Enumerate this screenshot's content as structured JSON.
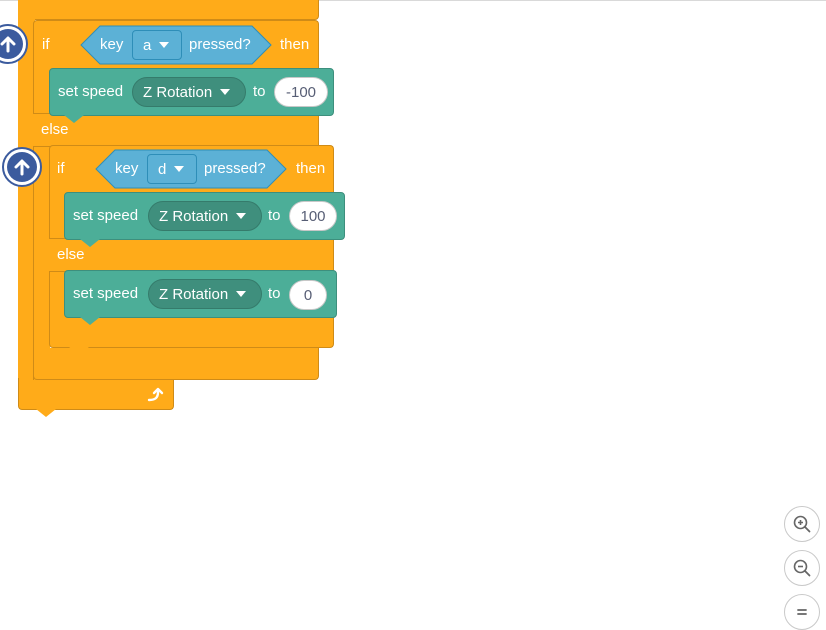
{
  "script": {
    "outer_if": {
      "if_label": "if",
      "then_label": "then",
      "else_label": "else",
      "condition": {
        "key_label": "key",
        "key_value": "a",
        "pressed_label": "pressed?"
      },
      "then_block": {
        "set_label": "set speed",
        "param": "Z Rotation",
        "to_label": "to",
        "value": "-100"
      }
    },
    "inner_if": {
      "if_label": "if",
      "then_label": "then",
      "else_label": "else",
      "condition": {
        "key_label": "key",
        "key_value": "d",
        "pressed_label": "pressed?"
      },
      "then_block": {
        "set_label": "set speed",
        "param": "Z Rotation",
        "to_label": "to",
        "value": "100"
      },
      "else_block": {
        "set_label": "set speed",
        "param": "Z Rotation",
        "to_label": "to",
        "value": "0"
      }
    }
  },
  "icons": {
    "collapse_icon": "arrow-up-icon",
    "loop_icon": "loop-arrow-icon",
    "zoom_in_icon": "zoom-in-icon",
    "zoom_out_icon": "zoom-out-icon",
    "reset_zoom_icon": "equals-icon"
  },
  "colors": {
    "control": "#ffab19",
    "motion": "#4cae98",
    "sensing": "#5cb1d6",
    "collapse_button": "#3b5b9e"
  }
}
